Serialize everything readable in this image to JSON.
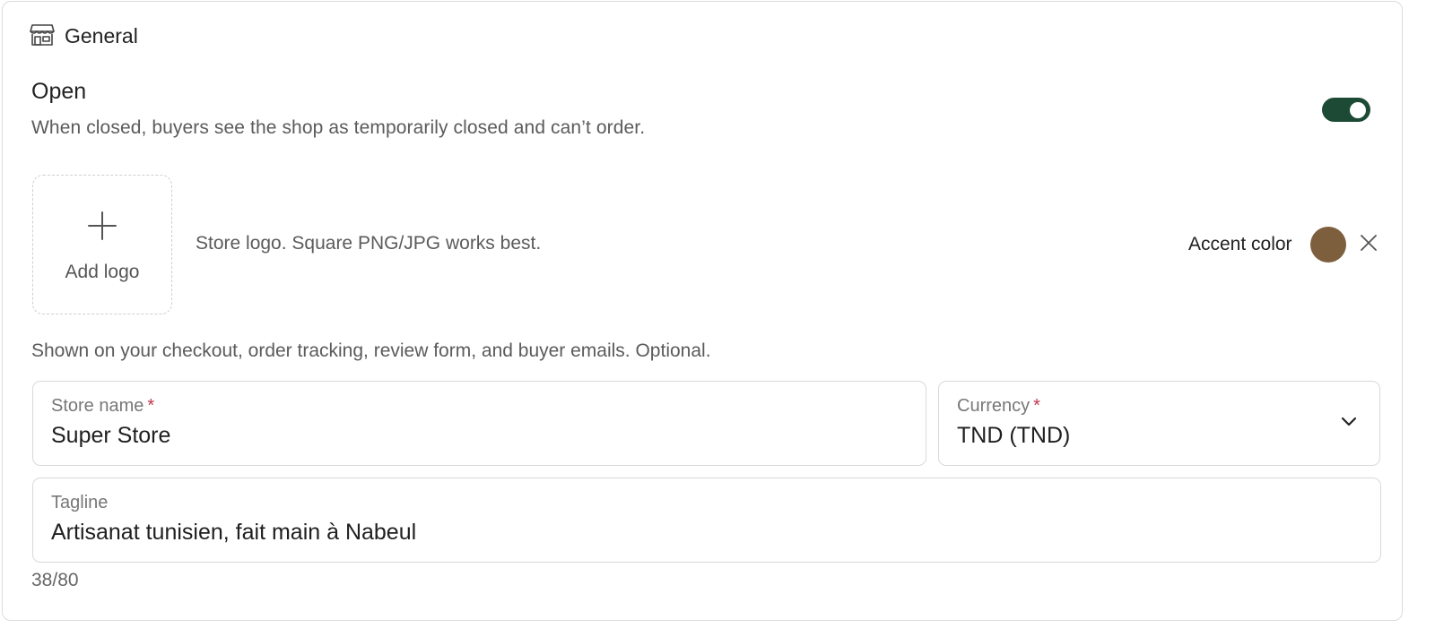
{
  "header": {
    "icon": "storefront-icon",
    "title": "General"
  },
  "open_setting": {
    "title": "Open",
    "description": "When closed, buyers see the shop as temporarily closed and can’t order.",
    "enabled": true,
    "toggle_color": "#1d4a35"
  },
  "logo": {
    "icon": "plus-icon",
    "add_label": "Add logo",
    "hint": "Store logo. Square PNG/JPG works best.",
    "usage_note": "Shown on your checkout, order tracking, review form, and buyer emails. Optional."
  },
  "accent": {
    "label": "Accent color",
    "color": "#7d5e3d",
    "clear_icon": "close-icon"
  },
  "store_name": {
    "label": "Store name",
    "required_mark": "*",
    "value": "Super Store"
  },
  "currency": {
    "label": "Currency",
    "required_mark": "*",
    "value": "TND (TND)",
    "icon": "chevron-down-icon"
  },
  "tagline": {
    "label": "Tagline",
    "value": "Artisanat tunisien, fait main à Nabeul",
    "counter": "38/80"
  }
}
